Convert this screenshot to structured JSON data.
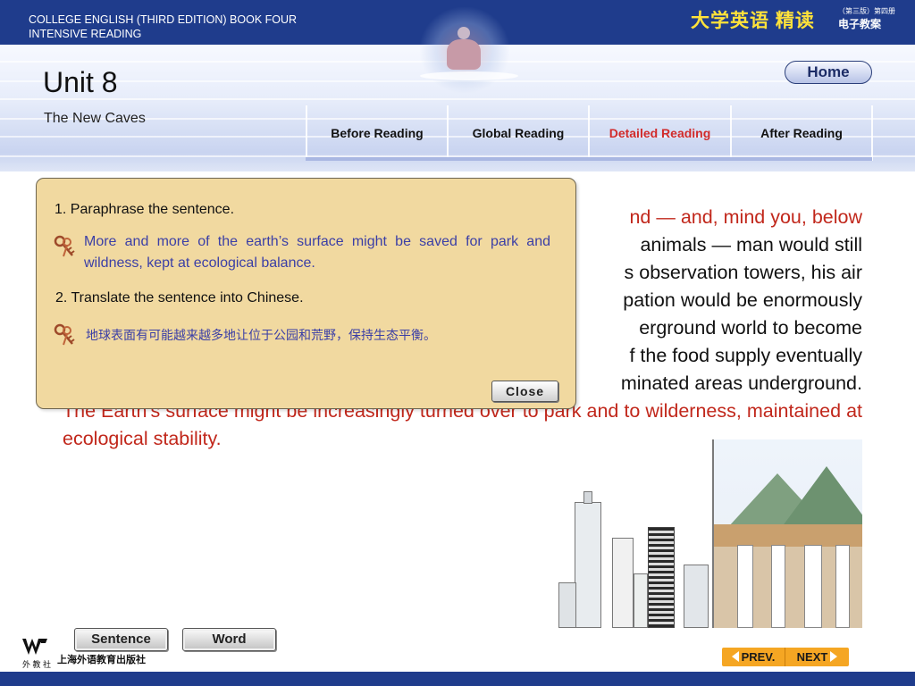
{
  "header": {
    "course_title": "COLLEGE ENGLISH (THIRD EDITION) BOOK FOUR\nINTENSIVE READING",
    "cn_title": "大学英语 精读",
    "edition_note": "（第三版）第四册",
    "cn_subtitle": "电子教案"
  },
  "unit": {
    "title": "Unit 8",
    "subtitle": "The New Caves"
  },
  "home_label": "Home",
  "nav_tabs": [
    {
      "label": "Before Reading",
      "active": false
    },
    {
      "label": "Global Reading",
      "active": false
    },
    {
      "label": "Detailed Reading",
      "active": true
    },
    {
      "label": "After Reading",
      "active": false
    }
  ],
  "passage": {
    "line1": "nd — and, mind you, below",
    "line2": "animals — man would still",
    "line3": "s observation towers, his air",
    "line4": "pation would be enormously",
    "line5": "erground world to become",
    "line6": "f the food supply eventually",
    "line7": "minated areas underground.",
    "line8": "The Earth's surface might be increasingly turned over to park and to wilderness, maintained at ecological stability."
  },
  "popup": {
    "q1": "1. Paraphrase the sentence.",
    "a1": "More and more of the earth’s surface might be saved for park and wildness, kept at ecological balance.",
    "q2": "2. Translate the sentence into Chinese.",
    "a2": "地球表面有可能越来越多地让位于公园和荒野，保持生态平衡。",
    "close_label": "Close"
  },
  "footer": {
    "sentence_label": "Sentence",
    "word_label": "Word",
    "publisher_mark": "外 教 社",
    "publisher_name": "上海外语教育出版社",
    "prev_label": "PREV.",
    "next_label": "NEXT"
  },
  "colors": {
    "header_blue": "#1f3c8c",
    "highlight_red": "#c1271b",
    "answer_blue": "#3b3fa6",
    "popup_bg": "#f1d9a0",
    "nav_orange": "#f5a623"
  },
  "icons": [
    "key-icon",
    "arrow-left-icon",
    "arrow-right-icon"
  ]
}
